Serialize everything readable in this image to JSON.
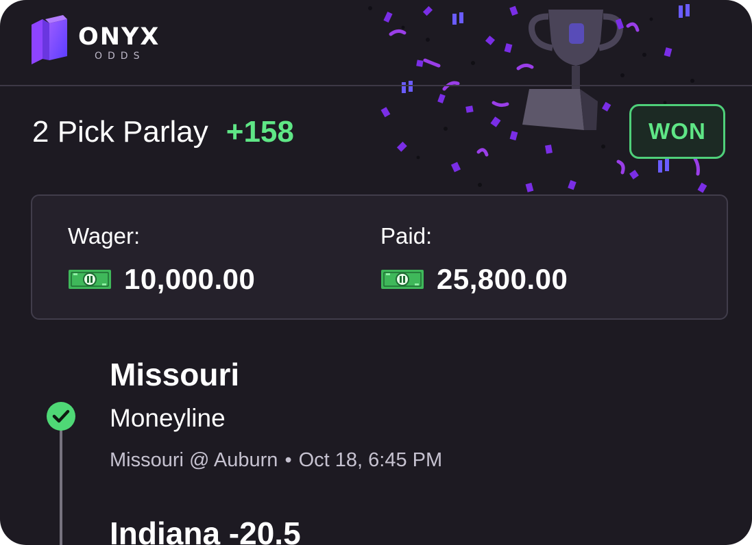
{
  "brand": {
    "name": "ONYX",
    "sub": "ODDS"
  },
  "bet": {
    "title": "2 Pick Parlay",
    "odds": "+158",
    "status": "WON"
  },
  "summary": {
    "wager_label": "Wager:",
    "wager_amount": "10,000.00",
    "paid_label": "Paid:",
    "paid_amount": "25,800.00"
  },
  "picks": [
    {
      "selection": "Missouri",
      "market": "Moneyline",
      "matchup": "Missouri @ Auburn",
      "separator": "•",
      "time": "Oct 18, 6:45 PM",
      "result_icon": "check-circle-icon"
    },
    {
      "selection": "Indiana -20.5"
    }
  ],
  "colors": {
    "background": "#1d1a22",
    "accent_green": "#5fe686",
    "brand_purple": "#7b4dff",
    "confetti_purple": "#8a3dff"
  },
  "icons": [
    "trophy-icon",
    "cash-icon",
    "check-circle-icon",
    "onyx-logo-icon"
  ]
}
